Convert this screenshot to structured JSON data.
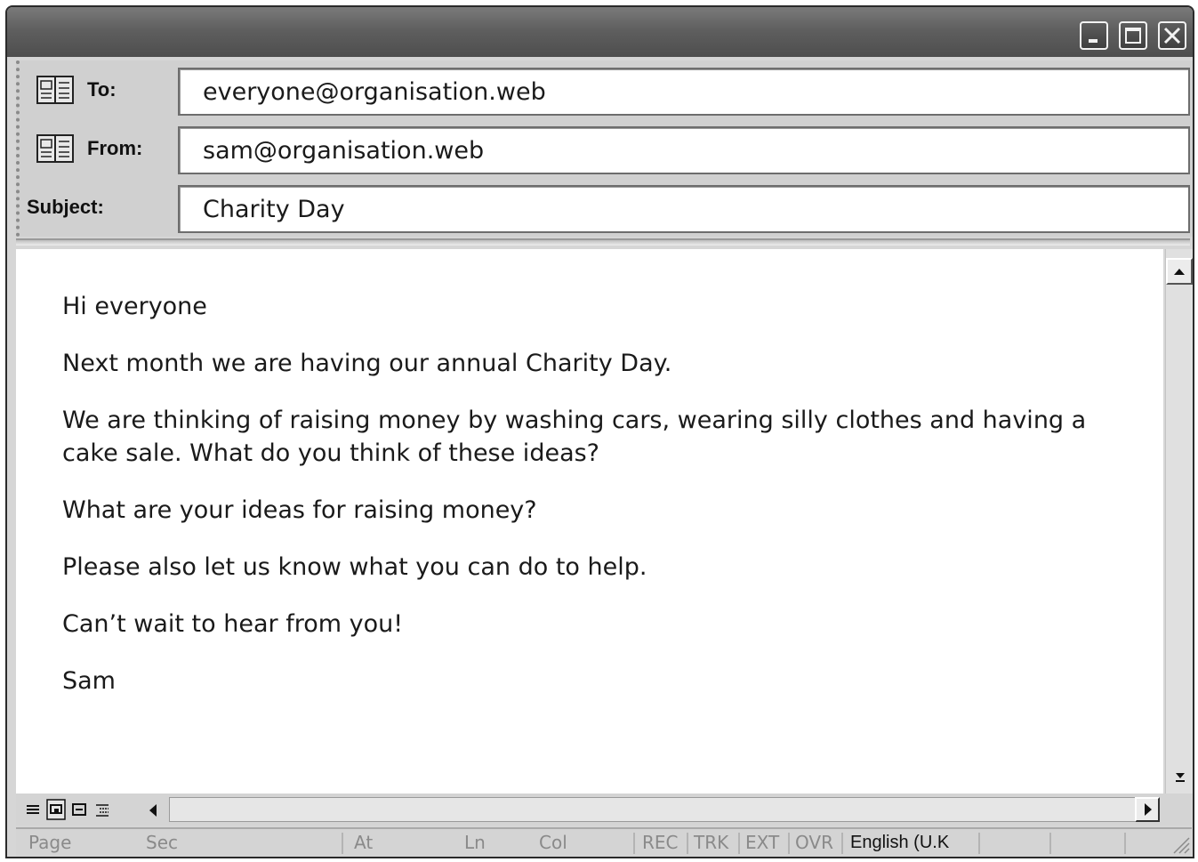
{
  "header": {
    "to_label": "To:",
    "to_value": "everyone@organisation.web",
    "from_label": "From:",
    "from_value": "sam@organisation.web",
    "subject_label": "Subject:",
    "subject_value": "Charity Day"
  },
  "body": {
    "lines": [
      "Hi everyone",
      "Next month we are having our annual Charity Day.",
      "We are thinking of raising money by washing cars, wearing silly clothes and having a cake sale. What do you think of these ideas?",
      "What are your ideas for raising money?",
      "Please also let us know what you can do to help.",
      "Can’t wait to hear from you!",
      "Sam"
    ]
  },
  "status": {
    "page": "Page",
    "sec": "Sec",
    "at": "At",
    "ln": "Ln",
    "col": "Col",
    "rec": "REC",
    "trk": "TRK",
    "ext": "EXT",
    "ovr": "OVR",
    "language": "English (U.K"
  },
  "icons": {
    "minimize": "minimize-icon",
    "maximize": "maximize-icon",
    "close": "close-icon",
    "address_book": "address-book-icon"
  }
}
